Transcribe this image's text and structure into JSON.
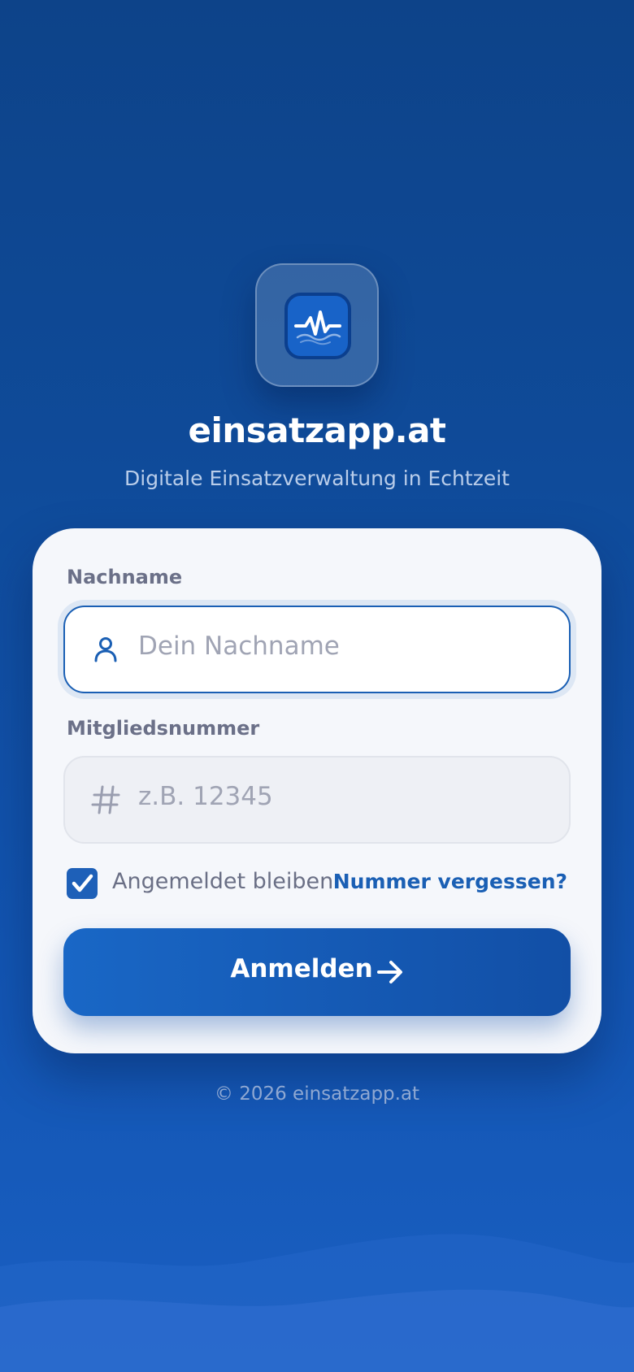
{
  "app": {
    "name": "einsatzapp.at",
    "tagline": "Digitale Einsatzverwaltung in Echtzeit",
    "logo_icon": "pulse-wave-icon"
  },
  "form": {
    "lastname": {
      "label": "Nachname",
      "placeholder": "Dein Nachname",
      "icon": "person-icon"
    },
    "member_number": {
      "label": "Mitgliedsnummer",
      "placeholder": "z.B. 12345",
      "icon": "hash-icon"
    },
    "remember": {
      "label": "Angemeldet bleiben",
      "checked": true
    },
    "forgot_link": "Nummer vergessen?",
    "submit_label": "Anmelden"
  },
  "footer": {
    "copyright": "© 2026 einsatzapp.at"
  },
  "colors": {
    "primary": "#1a5fb4",
    "background_top": "#0d4389",
    "background_bottom": "#1a5fc2",
    "card": "#f5f7fb",
    "label": "#6b7088"
  }
}
